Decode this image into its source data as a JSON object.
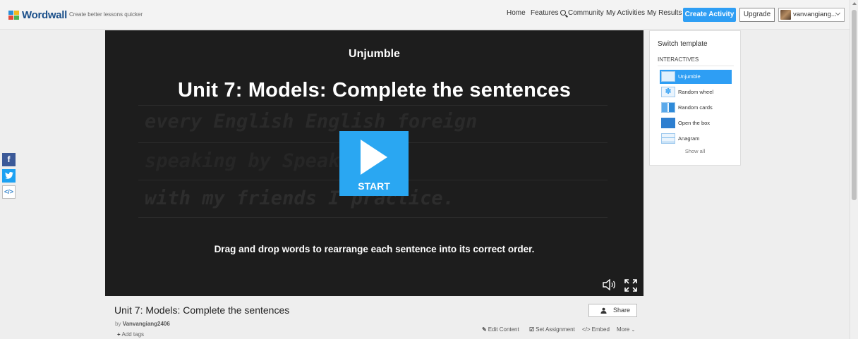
{
  "header": {
    "brand": "Wordwall",
    "tagline": "Create better lessons quicker",
    "nav": {
      "home": "Home",
      "features": "Features",
      "community": "Community",
      "my_activities": "My Activities",
      "my_results": "My Results"
    },
    "create_activity": "Create Activity",
    "upgrade": "Upgrade",
    "username": "vanvangiang..."
  },
  "social": {
    "facebook": "f",
    "twitter": "t",
    "embed": "</>"
  },
  "player": {
    "game_name": "Unjumble",
    "title": "Unit 7: Models: Complete the sentences",
    "background_rows": [
      "every  English  English  foreign",
      "speaking  by  Speaki",
      "with  my  friends  I  practice."
    ],
    "start_label": "START",
    "instructions": "Drag and drop words to rearrange each sentence into its correct order."
  },
  "activity": {
    "title": "Unit 7: Models: Complete the sentences",
    "by_prefix": "by",
    "author": "Vanvangiang2406",
    "add_tags": "Add tags",
    "share": "Share",
    "actions": {
      "edit": "Edit Content",
      "assign": "Set Assignment",
      "embed": "Embed",
      "more": "More"
    }
  },
  "templates_panel": {
    "heading": "Switch template",
    "section": "INTERACTIVES",
    "items": [
      {
        "label": "Unjumble",
        "icon": "unjumble-icon",
        "active": true
      },
      {
        "label": "Random wheel",
        "icon": "wheel-icon",
        "active": false
      },
      {
        "label": "Random cards",
        "icon": "cards-icon",
        "active": false
      },
      {
        "label": "Open the box",
        "icon": "box-icon",
        "active": false
      },
      {
        "label": "Anagram",
        "icon": "anagram-icon",
        "active": false
      }
    ],
    "show_all": "Show all"
  },
  "colors": {
    "accent": "#2e9ef4",
    "start_button": "#2aa7f2",
    "player_bg": "#1d1d1d",
    "facebook": "#3b5998",
    "twitter": "#1da1f2"
  }
}
